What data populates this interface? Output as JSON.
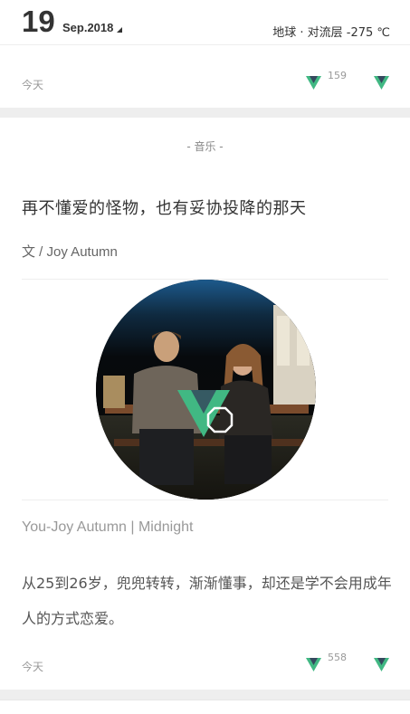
{
  "header": {
    "day": "19",
    "month": "Sep.2018",
    "weather": "地球 · 对流层 -275 ℃"
  },
  "top_feed_footer": {
    "date": "今天",
    "likes": "159"
  },
  "card": {
    "category": "- 音乐 -",
    "title": "再不懂爱的怪物，也有妥协投降的那天",
    "author": "文 / Joy Autumn",
    "song": "You-Joy Autumn | Midnight",
    "excerpt": "从25到26岁，兜兜转转，渐渐懂事，却还是学不会用成年人的方式恋爱。",
    "date": "今天",
    "likes": "558"
  },
  "colors": {
    "accent": "#41b883",
    "accent_dark": "#35495e",
    "divider": "#eeeeee",
    "gap": "#eeeeee"
  }
}
